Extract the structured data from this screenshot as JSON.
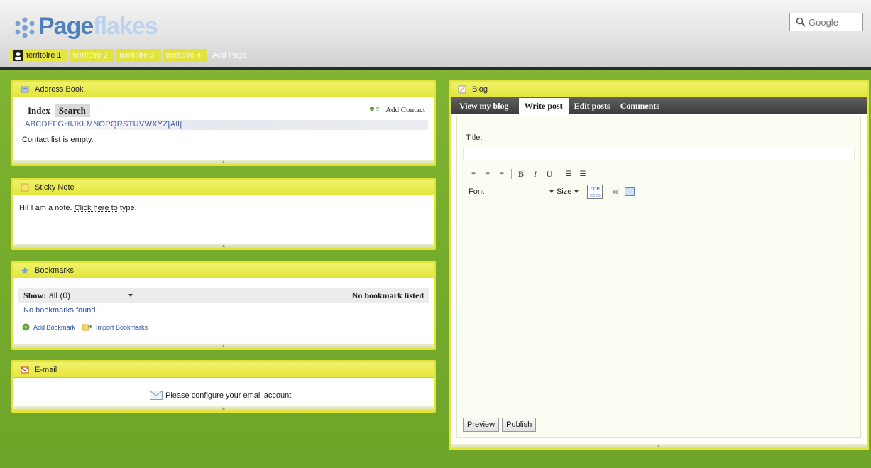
{
  "brand": {
    "logo_part1": "Page",
    "logo_part2": "flakes"
  },
  "search": {
    "placeholder": "Google"
  },
  "tabs": [
    {
      "label": "territoire 1",
      "active": true
    },
    {
      "label": "territoire 2"
    },
    {
      "label": "territoire 3"
    },
    {
      "label": "territoire 4"
    },
    {
      "label": "Add Page"
    }
  ],
  "address_book": {
    "title": "Address Book",
    "tab_index": "Index",
    "tab_search": "Search",
    "add_contact": "Add Contact",
    "letters": "ABCDEFGHIJKLMNOPQRSTUVWXYZ[All]",
    "empty": "Contact list is empty."
  },
  "sticky_note": {
    "title": "Sticky Note",
    "text_before": "Hi! I am a note. ",
    "link_text": "Click here to",
    "text_after": " type."
  },
  "bookmarks": {
    "title": "Bookmarks",
    "show_label": "Show:",
    "show_value": "all (0)",
    "status": "No bookmark listed",
    "not_found": "No bookmarks found.",
    "add_label": "Add Bookmark",
    "import_label": "Import Bookmarks"
  },
  "email": {
    "title": "E-mail",
    "message": "Please configure your email account"
  },
  "blog": {
    "title": "Blog",
    "tabs": [
      "View my blog",
      "Write post",
      "Edit posts",
      "Comments"
    ],
    "active_tab": "Write post",
    "title_label": "Title:",
    "font_label": "Font",
    "size_label": "Size",
    "code_label": "cde",
    "preview_label": "Preview",
    "publish_label": "Publish"
  },
  "colors": {
    "accent_green": "#78ad2c",
    "tab_yellow": "#e2e43a",
    "link_blue": "#2a4fa6"
  }
}
